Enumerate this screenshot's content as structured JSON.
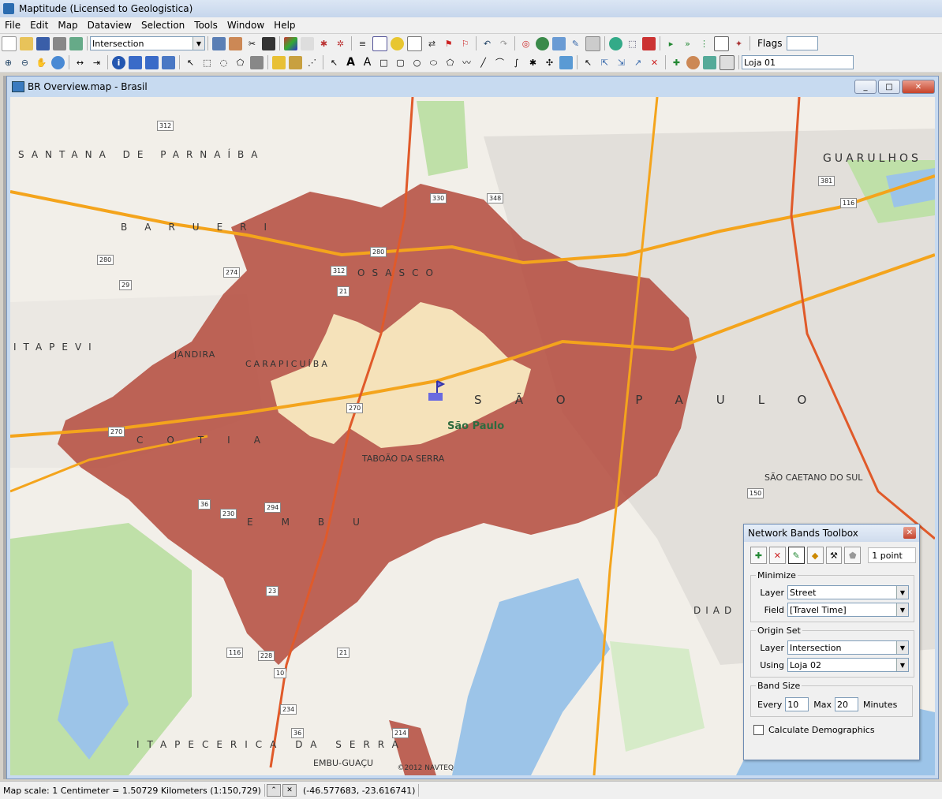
{
  "app": {
    "title": "Maptitude (Licensed to Geologistica)"
  },
  "menu": [
    "File",
    "Edit",
    "Map",
    "Dataview",
    "Selection",
    "Tools",
    "Window",
    "Help"
  ],
  "toolbar": {
    "layer_combo": "Intersection",
    "flags_label": "Flags",
    "loja_combo": "Loja 01"
  },
  "map_window": {
    "title": "BR Overview.map - Brasil",
    "btn_min": "_",
    "btn_max": "□",
    "btn_close": "✕"
  },
  "map": {
    "region_labels": [
      "SANTANA DE PARNAÍBA",
      "BARUERI",
      "OSASCO",
      "ITAPEVI",
      "JANDIRA",
      "CARAPICUÍBA",
      "COTIA",
      "EMBU",
      "SÃO PAULO",
      "GUARULHOS",
      "TABOÃO DA SERRA",
      "SÃO CAETANO DO SUL",
      "ITAPECERICA DA SERRA",
      "EMBU-GUAÇU",
      "DIAD"
    ],
    "city": "São Paulo",
    "shields": [
      "312",
      "330",
      "348",
      "280",
      "274",
      "29",
      "312",
      "21",
      "280",
      "270",
      "270",
      "36",
      "230",
      "294",
      "23",
      "116",
      "228",
      "21",
      "10",
      "234",
      "36",
      "214",
      "381",
      "116",
      "150"
    ],
    "copyright": "©2012 NAVTEQ",
    "colors": {
      "band_inner": "#f5e2ba",
      "band_outer": "#b44a3c",
      "water": "#9cc4e8",
      "park": "#bfe0a8"
    }
  },
  "toolbox": {
    "title": "Network Bands Toolbox",
    "close": "✕",
    "point_count": "1 point",
    "minimize": {
      "legend": "Minimize",
      "layer_label": "Layer",
      "layer_value": "Street",
      "field_label": "Field",
      "field_value": "[Travel Time]"
    },
    "origin": {
      "legend": "Origin Set",
      "layer_label": "Layer",
      "layer_value": "Intersection",
      "using_label": "Using",
      "using_value": "Loja 02"
    },
    "band": {
      "legend": "Band Size",
      "every_label": "Every",
      "every_value": "10",
      "max_label": "Max",
      "max_value": "20",
      "units": "Minutes"
    },
    "demographics_label": "Calculate Demographics"
  },
  "status": {
    "scale": "Map scale: 1 Centimeter = 1.50729 Kilometers (1:150,729)",
    "coords": "(-46.577683, -23.616741)"
  }
}
